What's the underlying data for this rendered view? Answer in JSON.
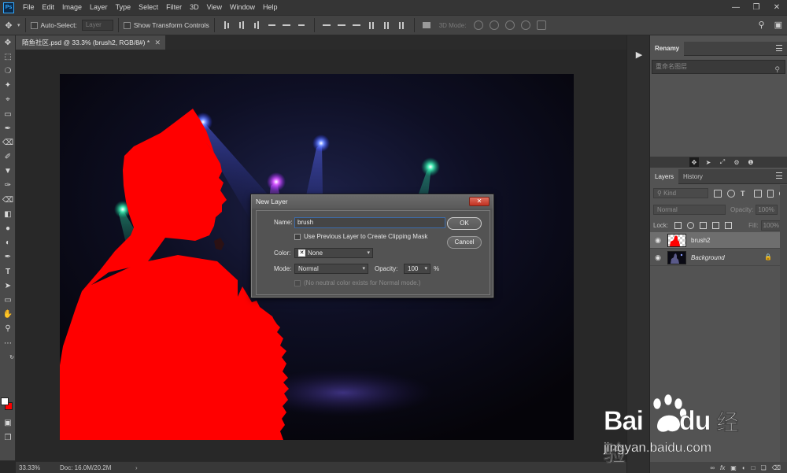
{
  "menubar": {
    "items": [
      "File",
      "Edit",
      "Image",
      "Layer",
      "Type",
      "Select",
      "Filter",
      "3D",
      "View",
      "Window",
      "Help"
    ]
  },
  "options": {
    "auto_select_label": "Auto-Select:",
    "auto_select_target": "Layer",
    "show_transform_label": "Show Transform Controls",
    "mode_3d_label": "3D Mode:"
  },
  "document": {
    "tab_title": "陌鱼社区.psd @ 33.3% (brush2, RGB/8#) *",
    "zoom": "33.33%",
    "doc_size": "Doc: 16.0M/20.2M"
  },
  "renamy": {
    "tab": "Renamy",
    "search_placeholder": "重命名图层"
  },
  "layers_panel": {
    "tabs": [
      "Layers",
      "History"
    ],
    "kind_label": "Kind",
    "blend_mode": "Normal",
    "opacity_label": "Opacity:",
    "opacity_value": "100%",
    "lock_label": "Lock:",
    "fill_label": "Fill:",
    "fill_value": "100%",
    "layers": [
      {
        "name": "brush2",
        "selected": true
      },
      {
        "name": "Background",
        "selected": false,
        "locked": true
      }
    ]
  },
  "dialog": {
    "title": "New Layer",
    "name_label": "Name:",
    "name_value": "brush",
    "clipping_label": "Use Previous Layer to Create Clipping Mask",
    "color_label": "Color:",
    "color_value": "None",
    "mode_label": "Mode:",
    "mode_value": "Normal",
    "opacity_label": "Opacity:",
    "opacity_value": "100",
    "opacity_unit": "%",
    "neutral_note": "(No neutral color exists for Normal mode.)",
    "ok_label": "OK",
    "cancel_label": "Cancel"
  },
  "watermark": {
    "brand": "Bai",
    "brand2": "du",
    "cn": "经验",
    "url": "jingyan.baidu.com"
  },
  "colors": {
    "silhouette": "#ff0000",
    "foreground": "#ffffff",
    "background": "#ff0000",
    "accent": "#31a8ff"
  }
}
